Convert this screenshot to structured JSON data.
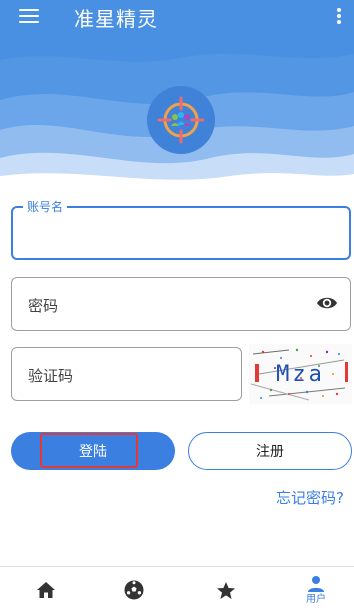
{
  "app_title": "准星精灵",
  "icons": {
    "menu": "menu-icon",
    "more": "more-vertical-icon",
    "logo": "crosshair-group-icon",
    "visibility": "eye-icon",
    "home": "home-icon",
    "explore": "soccer-ball-icon",
    "favorites": "star-icon",
    "user": "user-icon"
  },
  "colors": {
    "primary": "#3b7fe0",
    "header": "#4a90e2",
    "highlight_border": "#e53935",
    "nav_inactive": "#333333"
  },
  "form": {
    "username_label": "账号名",
    "username_value": "",
    "password_placeholder": "密码",
    "captcha_placeholder": "验证码",
    "captcha_image_text": "Mza"
  },
  "buttons": {
    "login": "登陆",
    "register": "注册",
    "forgot_password": "忘记密码?"
  },
  "bottom_nav": {
    "active_item": "user",
    "user_label": "用户"
  }
}
